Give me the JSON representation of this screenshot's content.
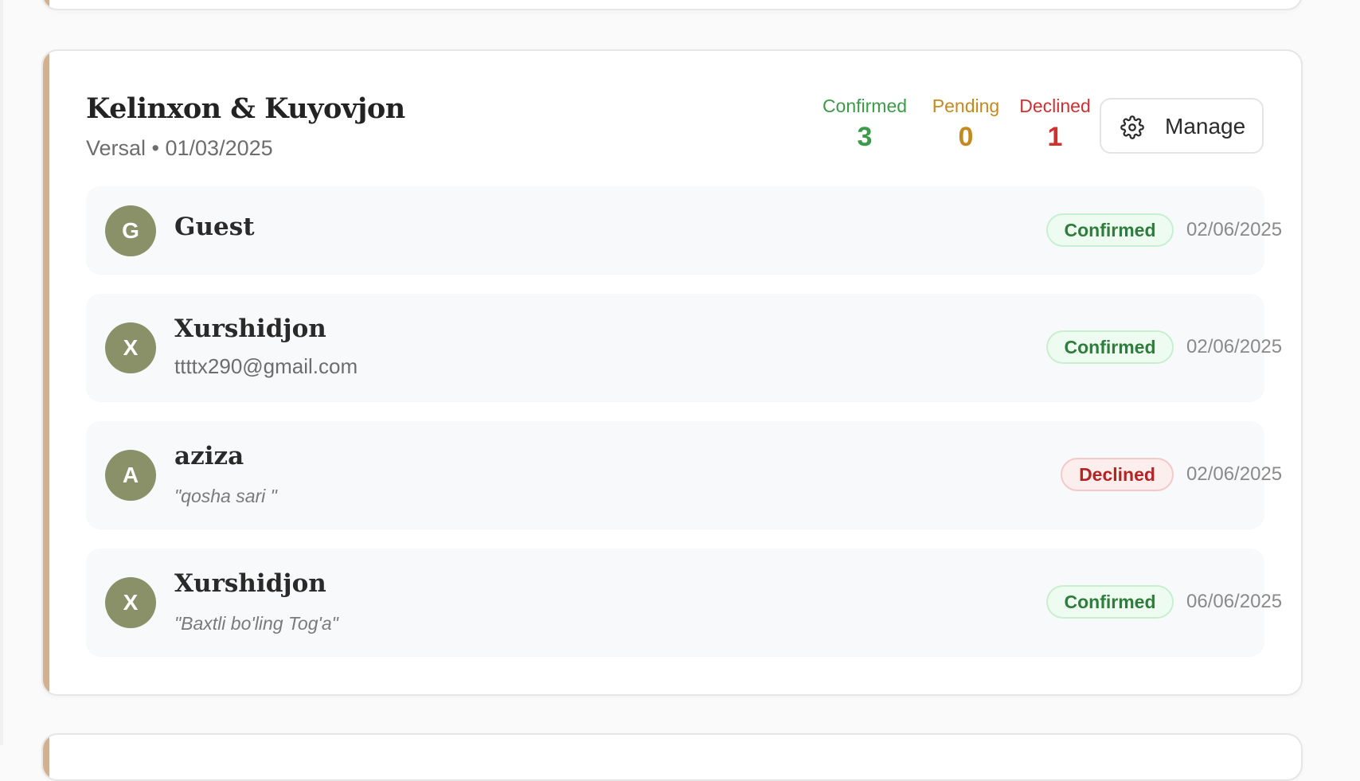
{
  "event": {
    "title": "Kelinxon & Kuyovjon",
    "venue": "Versal",
    "separator": "•",
    "date": "01/03/2025",
    "subtitle": "Versal • 01/03/2025"
  },
  "stats": {
    "confirmed": {
      "label": "Confirmed",
      "value": "3"
    },
    "pending": {
      "label": "Pending",
      "value": "0"
    },
    "declined": {
      "label": "Declined",
      "value": "1"
    }
  },
  "manage_button": {
    "label": "Manage",
    "icon": "gear-icon"
  },
  "guests": [
    {
      "initial": "G",
      "name": "Guest",
      "email": "",
      "note": "",
      "status": "Confirmed",
      "date": "02/06/2025"
    },
    {
      "initial": "X",
      "name": "Xurshidjon",
      "email": "ttttx290@gmail.com",
      "note": "",
      "status": "Confirmed",
      "date": "02/06/2025"
    },
    {
      "initial": "A",
      "name": "aziza",
      "email": "",
      "note": "\"qosha sari \"",
      "status": "Declined",
      "date": "02/06/2025"
    },
    {
      "initial": "X",
      "name": "Xurshidjon",
      "email": "",
      "note": "\"Baxtli bo'ling Tog'a\"",
      "status": "Confirmed",
      "date": "06/06/2025"
    }
  ],
  "colors": {
    "accent_border": "#d3b08f",
    "avatar_bg": "#8a9068",
    "confirmed": "#3d9a4b",
    "pending": "#c48a1f",
    "declined": "#cf3030"
  }
}
